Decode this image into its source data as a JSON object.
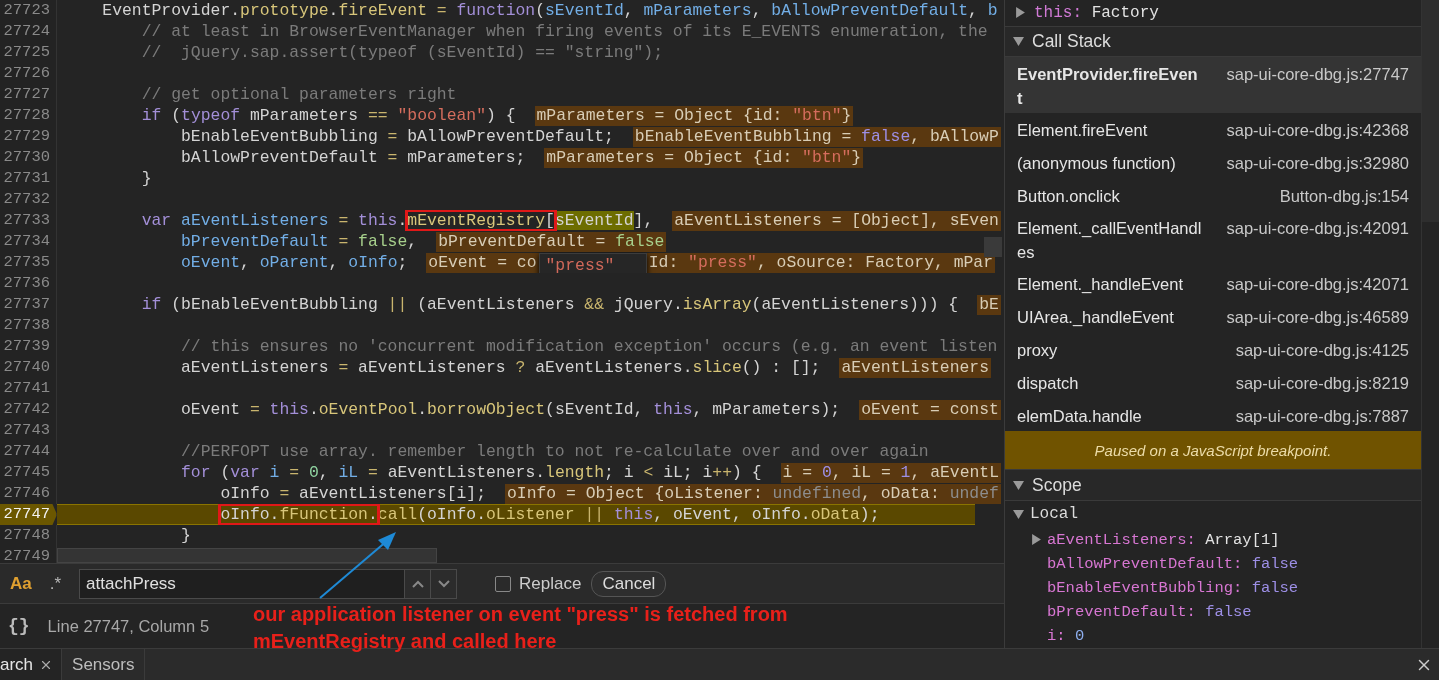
{
  "code": {
    "lines": [
      {
        "number": "27723",
        "current": false,
        "tokens": [
          {
            "kind": "pl",
            "text": "    EventProvider."
          },
          {
            "kind": "prop",
            "text": "prototype"
          },
          {
            "kind": "pl",
            "text": "."
          },
          {
            "kind": "prop",
            "text": "fireEvent"
          },
          {
            "kind": "op",
            "text": " = "
          },
          {
            "kind": "kw",
            "text": "function"
          },
          {
            "kind": "pl",
            "text": "("
          },
          {
            "kind": "param",
            "text": "sEventId"
          },
          {
            "kind": "pl",
            "text": ", "
          },
          {
            "kind": "param",
            "text": "mParameters"
          },
          {
            "kind": "pl",
            "text": ", "
          },
          {
            "kind": "param",
            "text": "bAllowPreventDefault"
          },
          {
            "kind": "pl",
            "text": ", "
          },
          {
            "kind": "param",
            "text": "b"
          }
        ]
      },
      {
        "number": "27724",
        "current": false,
        "tokens": [
          {
            "kind": "cm",
            "text": "        // at least in BrowserEventManager when firing events of its E_EVENTS enumeration, the"
          }
        ]
      },
      {
        "number": "27725",
        "current": false,
        "tokens": [
          {
            "kind": "cm",
            "text": "        //  jQuery.sap.assert(typeof (sEventId) == \"string\");"
          }
        ]
      },
      {
        "number": "27726",
        "current": false
      },
      {
        "number": "27727",
        "current": false,
        "tokens": [
          {
            "kind": "cm",
            "text": "        // get optional parameters right"
          }
        ]
      },
      {
        "number": "27728",
        "current": false,
        "tokens": [
          {
            "kind": "kw",
            "text": "        if"
          },
          {
            "kind": "pl",
            "text": " ("
          },
          {
            "kind": "kw",
            "text": "typeof"
          },
          {
            "kind": "pl",
            "text": " mParameters "
          },
          {
            "kind": "op",
            "text": "== "
          },
          {
            "kind": "str",
            "text": "\"boolean\""
          },
          {
            "kind": "pl",
            "text": ") {"
          }
        ],
        "inline": [
          {
            "kind": "pl",
            "text": "mParameters = Object {id: "
          },
          {
            "kind": "str",
            "text": "\"btn\""
          },
          {
            "kind": "pl",
            "text": "}"
          }
        ]
      },
      {
        "number": "27729",
        "current": false,
        "tokens": [
          {
            "kind": "pl",
            "text": "            bEnableEventBubbling "
          },
          {
            "kind": "op",
            "text": "="
          },
          {
            "kind": "pl",
            "text": " bAllowPreventDefault;"
          }
        ],
        "inline": [
          {
            "kind": "pl",
            "text": "bEnableEventBubbling = "
          },
          {
            "kind": "bool",
            "text": "false"
          },
          {
            "kind": "pl",
            "text": ", bAllowP"
          }
        ]
      },
      {
        "number": "27730",
        "current": false,
        "tokens": [
          {
            "kind": "pl",
            "text": "            bAllowPreventDefault "
          },
          {
            "kind": "op",
            "text": "="
          },
          {
            "kind": "pl",
            "text": " mParameters;"
          }
        ],
        "inline": [
          {
            "kind": "pl",
            "text": "mParameters = Object {id: "
          },
          {
            "kind": "str",
            "text": "\"btn\""
          },
          {
            "kind": "pl",
            "text": "}"
          }
        ]
      },
      {
        "number": "27731",
        "current": false,
        "tokens": [
          {
            "kind": "pl",
            "text": "        }"
          }
        ]
      },
      {
        "number": "27732",
        "current": false
      },
      {
        "number": "27733",
        "current": false,
        "tokens": [
          {
            "kind": "kw",
            "text": "        var"
          },
          {
            "kind": "param",
            "text": " aEventListeners"
          },
          {
            "kind": "op",
            "text": " = "
          },
          {
            "kind": "kw",
            "text": "this"
          },
          {
            "kind": "pl",
            "text": "."
          },
          {
            "kind": "boxed",
            "tokens": [
              {
                "kind": "prop",
                "text": "mEventRegistry"
              },
              {
                "kind": "pl",
                "text": "["
              }
            ]
          },
          {
            "kind": "hover",
            "tokens": [
              {
                "kind": "pl",
                "text": "sEventId"
              }
            ]
          },
          {
            "kind": "pl",
            "text": "],"
          }
        ],
        "inline": [
          {
            "kind": "pl",
            "text": "aEventListeners = [Object], sEven"
          }
        ]
      },
      {
        "number": "27734",
        "current": false,
        "tokens": [
          {
            "kind": "param",
            "text": "            bPreventDefault"
          },
          {
            "kind": "op",
            "text": " = "
          },
          {
            "kind": "lit",
            "text": "false"
          },
          {
            "kind": "pl",
            "text": ","
          }
        ],
        "inline": [
          {
            "kind": "pl",
            "text": "bPreventDefault = "
          },
          {
            "kind": "lit",
            "text": "false"
          }
        ]
      },
      {
        "number": "27735",
        "current": false,
        "tokens": [
          {
            "kind": "param",
            "text": "            oEvent"
          },
          {
            "kind": "pl",
            "text": ", "
          },
          {
            "kind": "param",
            "text": "oParent"
          },
          {
            "kind": "pl",
            "text": ", "
          },
          {
            "kind": "param",
            "text": "oInfo"
          },
          {
            "kind": "pl",
            "text": ";"
          }
        ],
        "inline": [
          {
            "kind": "pl",
            "text": "oEvent = co"
          },
          {
            "kind": "tooltip",
            "text": "\"press\""
          },
          {
            "kind": "pl",
            "text": "Id: "
          },
          {
            "kind": "str",
            "text": "\"press\""
          },
          {
            "kind": "pl",
            "text": ", oSource: Factory, mPar"
          }
        ]
      },
      {
        "number": "27736",
        "current": false
      },
      {
        "number": "27737",
        "current": false,
        "tokens": [
          {
            "kind": "kw",
            "text": "        if"
          },
          {
            "kind": "pl",
            "text": " (bEnableEventBubbling "
          },
          {
            "kind": "op",
            "text": "||"
          },
          {
            "kind": "pl",
            "text": " (aEventListeners "
          },
          {
            "kind": "op",
            "text": "&&"
          },
          {
            "kind": "pl",
            "text": " jQuery."
          },
          {
            "kind": "prop",
            "text": "isArray"
          },
          {
            "kind": "pl",
            "text": "(aEventListeners))) {"
          }
        ],
        "inline": [
          {
            "kind": "pl",
            "text": "bE"
          }
        ]
      },
      {
        "number": "27738",
        "current": false
      },
      {
        "number": "27739",
        "current": false,
        "tokens": [
          {
            "kind": "cm",
            "text": "            // this ensures no 'concurrent modification exception' occurs (e.g. an event listen"
          }
        ]
      },
      {
        "number": "27740",
        "current": false,
        "tokens": [
          {
            "kind": "pl",
            "text": "            aEventListeners "
          },
          {
            "kind": "op",
            "text": "="
          },
          {
            "kind": "pl",
            "text": " aEventListeners "
          },
          {
            "kind": "op",
            "text": "?"
          },
          {
            "kind": "pl",
            "text": " aEventListeners."
          },
          {
            "kind": "prop",
            "text": "slice"
          },
          {
            "kind": "pl",
            "text": "() : [];"
          }
        ],
        "inline": [
          {
            "kind": "pl",
            "text": "aEventListeners"
          }
        ]
      },
      {
        "number": "27741",
        "current": false
      },
      {
        "number": "27742",
        "current": false,
        "tokens": [
          {
            "kind": "pl",
            "text": "            oEvent "
          },
          {
            "kind": "op",
            "text": "= "
          },
          {
            "kind": "kw",
            "text": "this"
          },
          {
            "kind": "pl",
            "text": "."
          },
          {
            "kind": "prop",
            "text": "oEventPool"
          },
          {
            "kind": "pl",
            "text": "."
          },
          {
            "kind": "prop",
            "text": "borrowObject"
          },
          {
            "kind": "pl",
            "text": "(sEventId, "
          },
          {
            "kind": "kw",
            "text": "this"
          },
          {
            "kind": "pl",
            "text": ", mParameters);"
          }
        ],
        "inline": [
          {
            "kind": "pl",
            "text": "oEvent = const"
          }
        ]
      },
      {
        "number": "27743",
        "current": false
      },
      {
        "number": "27744",
        "current": false,
        "tokens": [
          {
            "kind": "cm",
            "text": "            //PERFOPT use array. remember length to not re-calculate over and over again"
          }
        ]
      },
      {
        "number": "27745",
        "current": false,
        "tokens": [
          {
            "kind": "kw",
            "text": "            for"
          },
          {
            "kind": "pl",
            "text": " ("
          },
          {
            "kind": "kw",
            "text": "var"
          },
          {
            "kind": "param",
            "text": " i"
          },
          {
            "kind": "op",
            "text": " = "
          },
          {
            "kind": "num",
            "text": "0"
          },
          {
            "kind": "pl",
            "text": ", "
          },
          {
            "kind": "param",
            "text": "iL"
          },
          {
            "kind": "op",
            "text": " = "
          },
          {
            "kind": "pl",
            "text": "aEventListeners."
          },
          {
            "kind": "prop",
            "text": "length"
          },
          {
            "kind": "pl",
            "text": "; i "
          },
          {
            "kind": "op",
            "text": "<"
          },
          {
            "kind": "pl",
            "text": " iL; i"
          },
          {
            "kind": "op",
            "text": "++"
          },
          {
            "kind": "pl",
            "text": ") {"
          }
        ],
        "inline": [
          {
            "kind": "pl",
            "text": "i = "
          },
          {
            "kind": "bool",
            "text": "0"
          },
          {
            "kind": "pl",
            "text": ", iL = "
          },
          {
            "kind": "bool",
            "text": "1"
          },
          {
            "kind": "pl",
            "text": ", aEventL"
          }
        ]
      },
      {
        "number": "27746",
        "current": false,
        "tokens": [
          {
            "kind": "pl",
            "text": "                oInfo "
          },
          {
            "kind": "op",
            "text": "="
          },
          {
            "kind": "pl",
            "text": " aEventListeners[i];"
          }
        ],
        "inline": [
          {
            "kind": "pl",
            "text": "oInfo = Object {oListener: "
          },
          {
            "kind": "undef",
            "text": "undefined"
          },
          {
            "kind": "pl",
            "text": ", oData: "
          },
          {
            "kind": "undef",
            "text": "undef"
          }
        ]
      },
      {
        "number": "27747",
        "current": true,
        "tokens": [
          {
            "kind": "boxed",
            "tokens": [
              {
                "kind": "pl",
                "text": "                oInfo."
              },
              {
                "kind": "prop",
                "text": "fFunction"
              },
              {
                "kind": "pl",
                "text": "."
              }
            ]
          },
          {
            "kind": "prop",
            "text": "call"
          },
          {
            "kind": "pl",
            "text": "(oInfo."
          },
          {
            "kind": "prop",
            "text": "oListener"
          },
          {
            "kind": "op",
            "text": " || "
          },
          {
            "kind": "kw",
            "text": "this"
          },
          {
            "kind": "pl",
            "text": ", oEvent, oInfo."
          },
          {
            "kind": "prop",
            "text": "oData"
          },
          {
            "kind": "pl",
            "text": ");"
          }
        ]
      },
      {
        "number": "27748",
        "current": false,
        "tokens": [
          {
            "kind": "pl",
            "text": "            }"
          }
        ]
      },
      {
        "number": "27749",
        "current": false
      }
    ]
  },
  "search_bar": {
    "match_case": {
      "label": "Aa",
      "on": true
    },
    "regex": {
      "label": ".*",
      "on": false
    },
    "query": "attachPress",
    "replace": {
      "label": "Replace",
      "checked": false
    },
    "cancel": "Cancel"
  },
  "status_bar": {
    "format_icon": "{}",
    "position": "Line 27747, Column 5"
  },
  "annotation": {
    "text": "our application listener on event \"press\" is fetched from mEventRegistry and called here"
  },
  "drawer_tabs": [
    {
      "label": "arch",
      "closable": true,
      "selected": true
    },
    {
      "label": "Sensors",
      "closable": false,
      "selected": false
    }
  ],
  "sidebar": {
    "this_row": {
      "name": "this:",
      "value": "Factory",
      "expanded": false
    },
    "call_stack": {
      "title": "Call Stack",
      "expanded": true,
      "frames": [
        {
          "name": "EventProvider.fireEvent",
          "location": "sap-ui-core-dbg.js:27747",
          "selected": true
        },
        {
          "name": "Element.fireEvent",
          "location": "sap-ui-core-dbg.js:42368",
          "selected": false
        },
        {
          "name": "(anonymous function)",
          "location": "sap-ui-core-dbg.js:32980",
          "selected": false
        },
        {
          "name": "Button.onclick",
          "location": "Button-dbg.js:154",
          "selected": false
        },
        {
          "name": "Element._callEventHandles",
          "location": "sap-ui-core-dbg.js:42091",
          "selected": false
        },
        {
          "name": "Element._handleEvent",
          "location": "sap-ui-core-dbg.js:42071",
          "selected": false
        },
        {
          "name": "UIArea._handleEvent",
          "location": "sap-ui-core-dbg.js:46589",
          "selected": false
        },
        {
          "name": "proxy",
          "location": "sap-ui-core-dbg.js:4125",
          "selected": false
        },
        {
          "name": "dispatch",
          "location": "sap-ui-core-dbg.js:8219",
          "selected": false
        },
        {
          "name": "elemData.handle",
          "location": "sap-ui-core-dbg.js:7887",
          "selected": false
        }
      ]
    },
    "paused_message": "Paused on a JavaScript breakpoint.",
    "scope": {
      "title": "Scope",
      "expanded": true,
      "groups": [
        {
          "title": "Local",
          "expanded": true,
          "variables": [
            {
              "name": "aEventListeners:",
              "value": "Array[1]",
              "kind": "object",
              "expandable": true
            },
            {
              "name": "bAllowPreventDefault:",
              "value": "false",
              "kind": "boolean",
              "expandable": false
            },
            {
              "name": "bEnableEventBubbling:",
              "value": "false",
              "kind": "boolean",
              "expandable": false
            },
            {
              "name": "bPreventDefault:",
              "value": "false",
              "kind": "boolean",
              "expandable": false
            },
            {
              "name": "i:",
              "value": "0",
              "kind": "number",
              "expandable": false
            }
          ]
        }
      ]
    }
  }
}
